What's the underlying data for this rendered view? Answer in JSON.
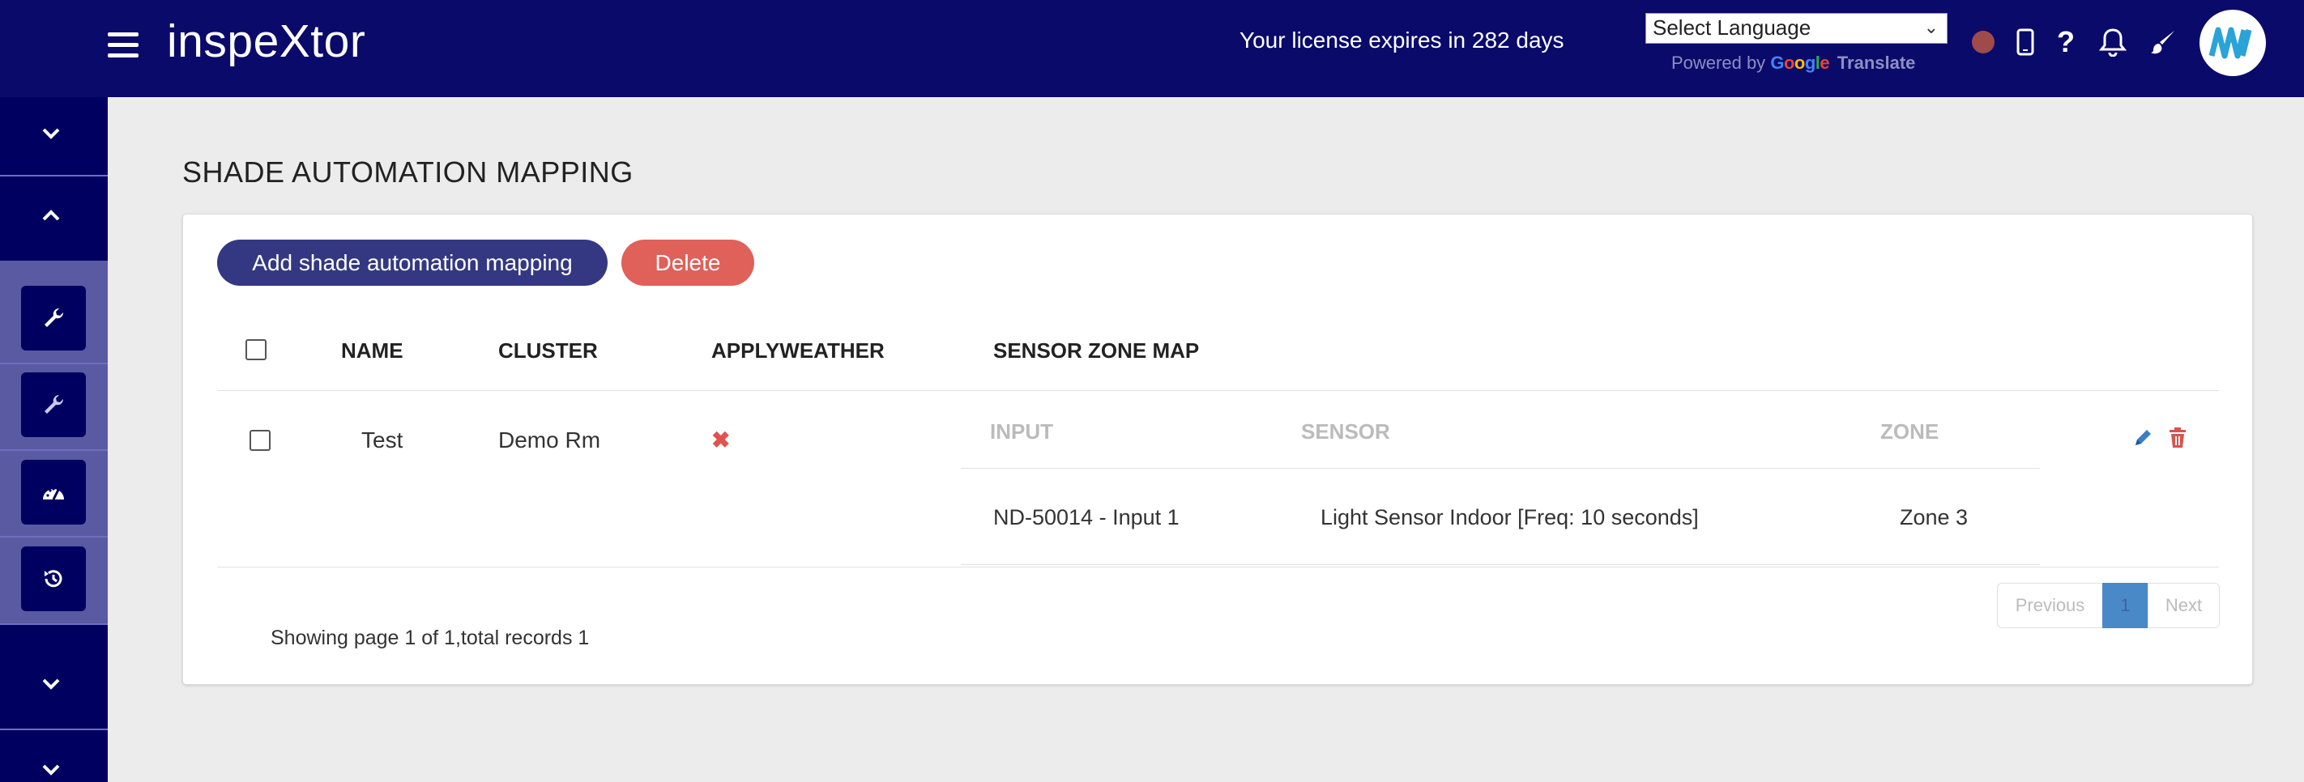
{
  "header": {
    "brand": "inspeXtor",
    "license": "Your license expires in 282 days",
    "language_select": "Select Language",
    "powered_by": "Powered by",
    "google": "Google",
    "translate": "Translate",
    "icons": [
      "mobile-icon",
      "help-icon",
      "bell-icon",
      "brush-icon"
    ]
  },
  "page": {
    "title": "SHADE AUTOMATION MAPPING"
  },
  "toolbar": {
    "add_label": "Add shade automation mapping",
    "delete_label": "Delete"
  },
  "table": {
    "headers": [
      "NAME",
      "CLUSTER",
      "APPLYWEATHER",
      "SENSOR ZONE MAP"
    ],
    "sub_headers": [
      "INPUT",
      "SENSOR",
      "ZONE"
    ],
    "rows": [
      {
        "name": "Test",
        "cluster": "Demo Rm",
        "applyweather": "✖",
        "sensor_map": [
          {
            "input": "ND-50014 - Input 1",
            "sensor": "Light Sensor Indoor [Freq: 10 seconds]",
            "zone": "Zone 3"
          }
        ]
      }
    ]
  },
  "pagination": {
    "previous": "Previous",
    "current": "1",
    "next": "Next",
    "summary": "Showing page 1 of 1,total records 1"
  },
  "colors": {
    "header_bg": "#0a0a6b",
    "primary": "#343882",
    "danger": "#e0605a",
    "edit": "#3b7dc4",
    "delete_icon": "#d9534f"
  }
}
